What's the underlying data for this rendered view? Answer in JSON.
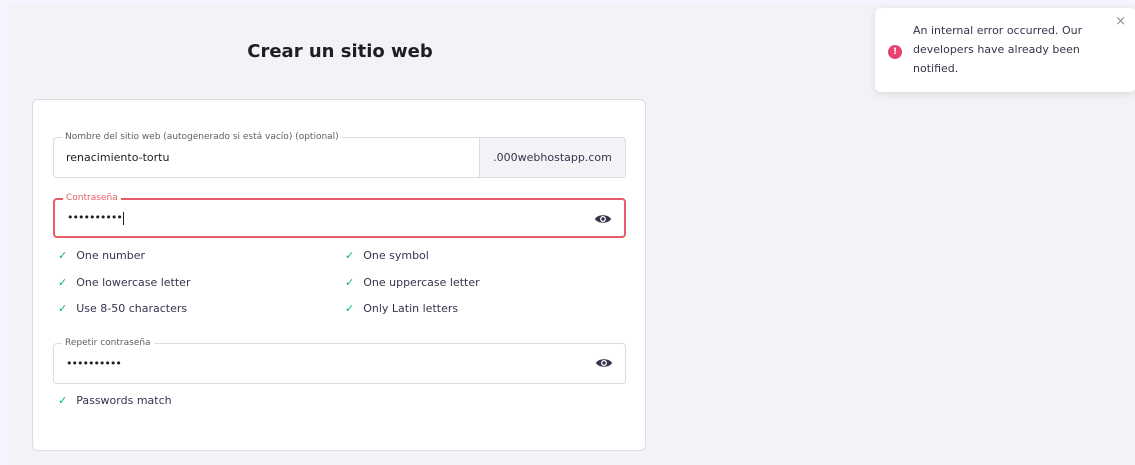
{
  "page": {
    "title": "Crear un sitio web"
  },
  "form": {
    "site_name": {
      "label": "Nombre del sitio web (autogenerado si está vacío) (optional)",
      "value": "renacimiento-tortu",
      "domain_suffix": ".000webhostapp.com"
    },
    "password": {
      "label": "Contraseña",
      "value_masked": "••••••••••",
      "visibility_icon": "eye-icon",
      "state": "error",
      "border_color": "#e85c6a"
    },
    "requirements": [
      {
        "label": "One number",
        "met": true
      },
      {
        "label": "One symbol",
        "met": true
      },
      {
        "label": "One lowercase letter",
        "met": true
      },
      {
        "label": "One uppercase letter",
        "met": true
      },
      {
        "label": "Use 8-50 characters",
        "met": true
      },
      {
        "label": "Only Latin letters",
        "met": true
      }
    ],
    "repeat_password": {
      "label": "Repetir contraseña",
      "value_masked": "••••••••••",
      "visibility_icon": "eye-icon"
    },
    "match_status": {
      "label": "Passwords match",
      "met": true
    },
    "check_symbol": "✓",
    "check_color": "#00b090"
  },
  "toast": {
    "message": "An internal error occurred. Our developers have already been notified.",
    "icon": "error-alert-icon",
    "icon_glyph": "!",
    "icon_color": "#e8436d",
    "close_glyph": "×"
  }
}
